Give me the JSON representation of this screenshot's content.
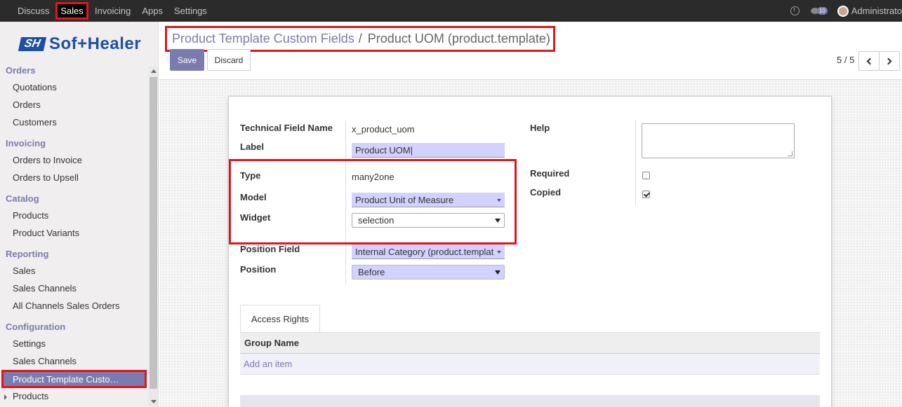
{
  "topbar": {
    "menu": [
      "Discuss",
      "Sales",
      "Invoicing",
      "Apps",
      "Settings"
    ],
    "active": "Sales",
    "notification_count": "10",
    "user": "Administrato"
  },
  "sidebar": {
    "logo_mark": "SH",
    "logo_text": "Sof+Healer",
    "sections": {
      "orders": {
        "header": "Orders",
        "items": [
          "Quotations",
          "Orders",
          "Customers"
        ]
      },
      "invoicing": {
        "header": "Invoicing",
        "items": [
          "Orders to Invoice",
          "Orders to Upsell"
        ]
      },
      "catalog": {
        "header": "Catalog",
        "items": [
          "Products",
          "Product Variants"
        ]
      },
      "reporting": {
        "header": "Reporting",
        "items": [
          "Sales",
          "Sales Channels",
          "All Channels Sales Orders"
        ]
      },
      "configuration": {
        "header": "Configuration",
        "items": [
          "Settings",
          "Sales Channels",
          "Product Template Custo…",
          "Products"
        ]
      }
    }
  },
  "breadcrumb": {
    "parent": "Product Template Custom Fields",
    "separator": "/",
    "current": "Product UOM (product.template)"
  },
  "buttons": {
    "save": "Save",
    "discard": "Discard"
  },
  "pager": {
    "text": "5 / 5"
  },
  "form": {
    "technical_field_name": {
      "label": "Technical Field Name",
      "value": "x_product_uom"
    },
    "label": {
      "label": "Label",
      "value": "Product UOM|"
    },
    "type": {
      "label": "Type",
      "value": "many2one"
    },
    "model": {
      "label": "Model",
      "value": "Product Unit of Measure"
    },
    "widget": {
      "label": "Widget",
      "value": "selection"
    },
    "position_field": {
      "label": "Position Field",
      "value": "Internal Category (product.templat"
    },
    "position": {
      "label": "Position",
      "value": "Before"
    },
    "help": {
      "label": "Help",
      "value": ""
    },
    "required": {
      "label": "Required",
      "checked": false
    },
    "copied": {
      "label": "Copied",
      "checked": true
    }
  },
  "tabs": {
    "access_rights": "Access Rights"
  },
  "table": {
    "header": "Group Name",
    "add_item": "Add an item"
  },
  "colors": {
    "accent": "#7c7bad",
    "highlight_border": "#e0161b",
    "topbar": "#2b2b2b",
    "input_bg": "#d2d2ff"
  }
}
